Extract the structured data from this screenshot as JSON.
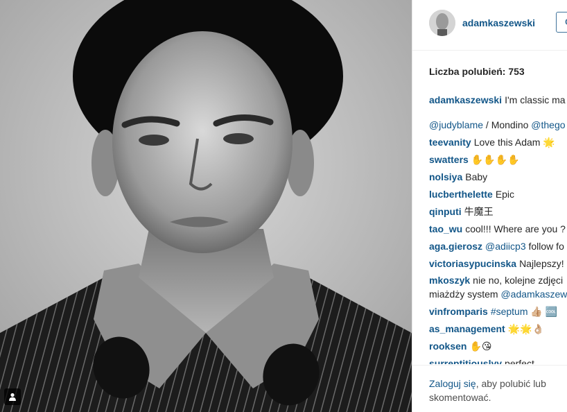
{
  "post": {
    "username": "adamkaszewski",
    "follow_label": "Obserwuj",
    "likes_label": "Liczba polubień: 753",
    "caption_user": "adamkaszewski",
    "caption_text": "I'm classic ma",
    "caption_continued": [
      {
        "text": "@judyblame",
        "mention": true
      },
      {
        "text": " / Mondino ",
        "mention": false
      },
      {
        "text": "@thego",
        "mention": true
      }
    ]
  },
  "comments": [
    {
      "user": "teevanity",
      "text": "Love this Adam 🌟"
    },
    {
      "user": "swatters",
      "text": "✋✋✋✋"
    },
    {
      "user": "nolsiya",
      "text": "Baby"
    },
    {
      "user": "lucberthelette",
      "text": "Epic"
    },
    {
      "user": "qinputi",
      "text": "牛魔王"
    },
    {
      "user": "tao_wu",
      "text": "cool!!! Where are you ?"
    },
    {
      "user": "aga.gierosz",
      "mention": "@adiicp3",
      "text": " follow fo"
    },
    {
      "user": "victoriasypucinska",
      "text": "Najlepszy!"
    },
    {
      "user": "mkoszyk",
      "text": "nie no, kolejne zdjęci",
      "text2": "miażdży system ",
      "mention2": "@adamkaszew",
      "wrap": true
    },
    {
      "user": "vinfromparis",
      "mention": "#septum",
      "text": " 👍🏼 🆒"
    },
    {
      "user": "as_management",
      "text": "🌟🌟👌🏼"
    },
    {
      "user": "rooksen",
      "text": "✋😘"
    },
    {
      "user": "surreptitiouslyy",
      "text": "perfect"
    }
  ],
  "footer": {
    "login_link": "Zaloguj się",
    "rest_text": ", aby polubić lub skomentować."
  },
  "icons": {
    "user_tag": "user-tag-icon",
    "avatar": "avatar"
  },
  "colors": {
    "username_blue": "#125688",
    "text_dark": "#262626",
    "border": "#efefef"
  }
}
